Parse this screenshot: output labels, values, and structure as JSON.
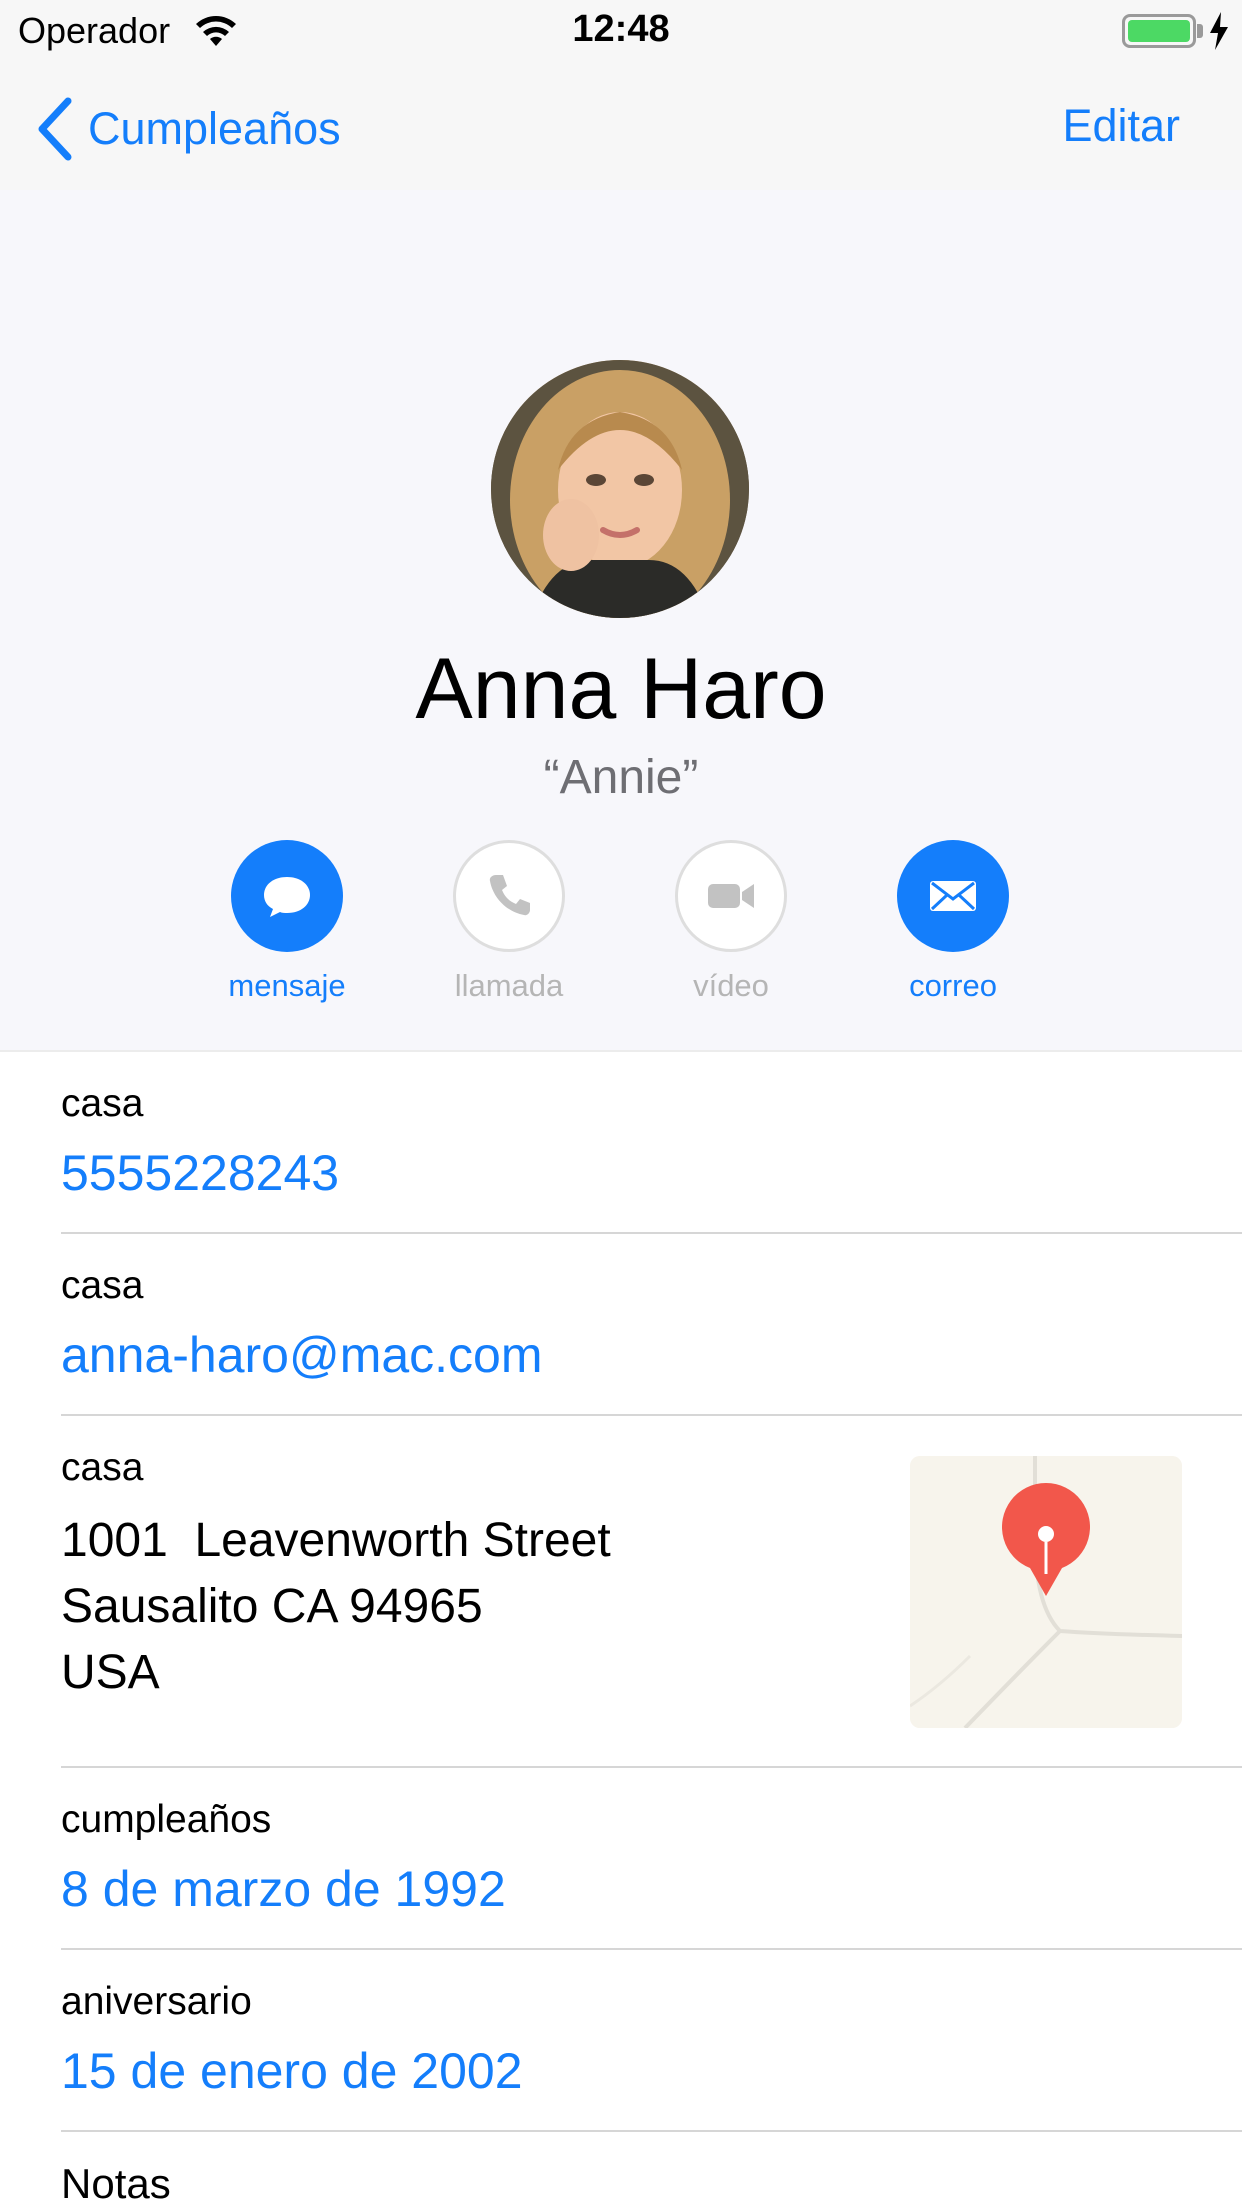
{
  "status_bar": {
    "carrier": "Operador",
    "time": "12:48"
  },
  "nav": {
    "back_label": "Cumpleaños",
    "edit_label": "Editar"
  },
  "contact": {
    "name": "Anna Haro",
    "nickname": "“Annie”"
  },
  "actions": [
    {
      "label": "mensaje",
      "icon": "message-bubble-icon",
      "enabled": true
    },
    {
      "label": "llamada",
      "icon": "phone-icon",
      "enabled": false
    },
    {
      "label": "vídeo",
      "icon": "video-camera-icon",
      "enabled": false
    },
    {
      "label": "correo",
      "icon": "envelope-icon",
      "enabled": true
    }
  ],
  "details": {
    "phone": {
      "label": "casa",
      "value": "5555228243"
    },
    "email": {
      "label": "casa",
      "value": "anna-haro@mac.com"
    },
    "address": {
      "label": "casa",
      "line1": "1001  Leavenworth Street",
      "line2": "Sausalito CA 94965",
      "line3": "USA"
    },
    "birthday": {
      "label": "cumpleaños",
      "value": "8 de marzo de 1992"
    },
    "anniversary": {
      "label": "aniversario",
      "value": "15 de enero de 2002"
    },
    "notes": {
      "label": "Notas"
    }
  },
  "colors": {
    "accent": "#147efb",
    "battery": "#4cd964",
    "map_pin": "#f2574b",
    "disabled": "#b5b5b5"
  }
}
